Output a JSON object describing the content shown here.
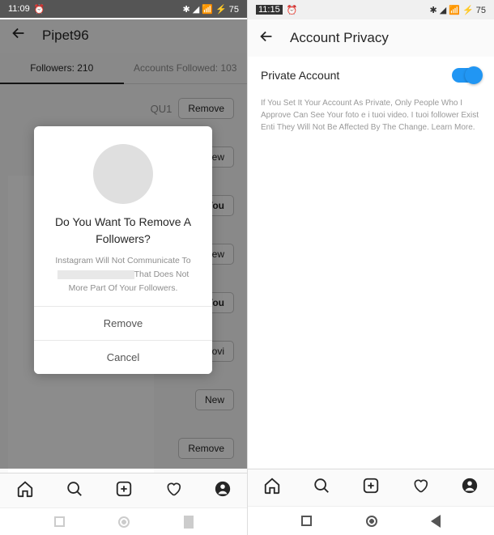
{
  "left": {
    "status": {
      "time": "11:09",
      "alarm": "⏰",
      "icons": "✱ ◢ 📶 ⚡ 75"
    },
    "header": {
      "username": "Pipet96"
    },
    "tabs": {
      "followers": "Followers: 210",
      "following": "Accounts Followed: 103"
    },
    "rows": [
      {
        "btn": "Remove",
        "tag": "QU1"
      },
      {
        "btn": "New"
      },
      {
        "btn": "You",
        "youStyle": true
      },
      {
        "btn": "New"
      },
      {
        "btn": "You",
        "youStyle": true
      },
      {
        "btn": "Luovi"
      },
      {
        "btn": "New"
      },
      {
        "btn": "Remove"
      }
    ],
    "modal": {
      "title_line1": "Do You Want To Remove A",
      "title_line2": "Followers?",
      "sub_line1": "Instagram Will Not Communicate To",
      "sub_line2_after": "That Does Not",
      "sub_line3": "More Part Of Your Followers.",
      "remove": "Remove",
      "cancel": "Cancel"
    }
  },
  "right": {
    "status": {
      "time": "11:15",
      "alarm": "⏰",
      "icons": "✱ ◢ 📶 ⚡ 75"
    },
    "header": {
      "title": "Account Privacy"
    },
    "privacy": {
      "row_label": "Private Account",
      "desc": "If You Set It Your Account As Private, Only People Who I Approve Can See Your foto e i tuoi video. I tuoi follower Exist Enti They Will Not Be Affected By The Change. Learn More."
    }
  }
}
